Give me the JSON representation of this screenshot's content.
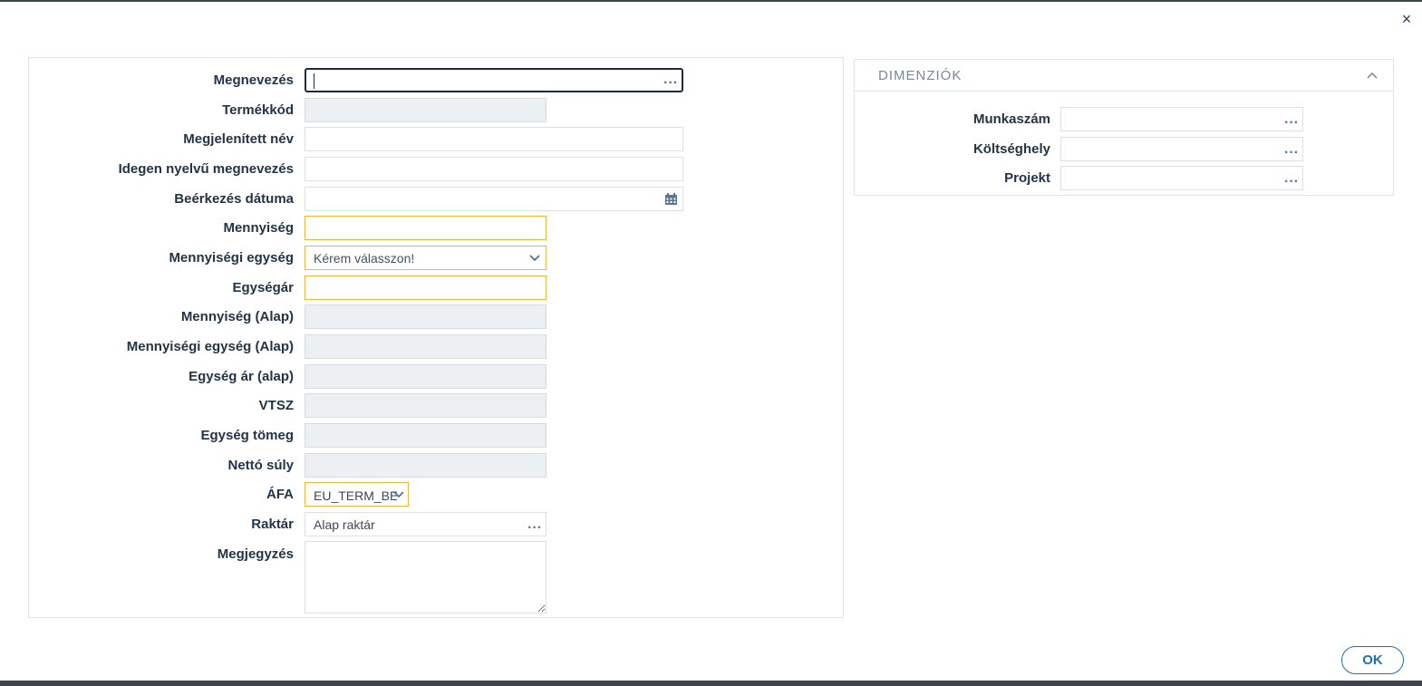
{
  "window": {
    "close_glyph": "×"
  },
  "form": {
    "fields": {
      "megnevezes": {
        "label": "Megnevezés",
        "value": ""
      },
      "termekkod": {
        "label": "Termékkód",
        "value": ""
      },
      "megjelenitett_nev": {
        "label": "Megjelenített név",
        "value": ""
      },
      "idegen_nyelvu": {
        "label": "Idegen nyelvű megnevezés",
        "value": ""
      },
      "beerkezes_datuma": {
        "label": "Beérkezés dátuma",
        "value": ""
      },
      "mennyiseg": {
        "label": "Mennyiség",
        "value": ""
      },
      "mennyisegi_egyseg": {
        "label": "Mennyiségi egység",
        "value": "Kérem válasszon!"
      },
      "egysegar": {
        "label": "Egységár",
        "value": ""
      },
      "mennyiseg_alap": {
        "label": "Mennyiség (Alap)",
        "value": ""
      },
      "mennyisegi_egyseg_alap": {
        "label": "Mennyiségi egység (Alap)",
        "value": ""
      },
      "egyseg_ar_alap": {
        "label": "Egység ár (alap)",
        "value": ""
      },
      "vtsz": {
        "label": "VTSZ",
        "value": ""
      },
      "egyseg_tomeg": {
        "label": "Egység tömeg",
        "value": ""
      },
      "netto_suly": {
        "label": "Nettó súly",
        "value": ""
      },
      "afa": {
        "label": "ÁFA",
        "value": "EU_TERM_BES"
      },
      "raktar": {
        "label": "Raktár",
        "value": "Alap raktár"
      },
      "megjegyzes": {
        "label": "Megjegyzés",
        "value": ""
      }
    }
  },
  "dimensions": {
    "title": "DIMENZIÓK",
    "collapsed": false,
    "fields": {
      "munkaszam": {
        "label": "Munkaszám",
        "value": ""
      },
      "koltseghely": {
        "label": "Költséghely",
        "value": ""
      },
      "projekt": {
        "label": "Projekt",
        "value": ""
      }
    }
  },
  "footer": {
    "ok_label": "OK"
  },
  "colors": {
    "required_border": "#f0b43c",
    "disabled_bg": "#edf0f3",
    "accent": "#1f6fa8",
    "frame": "#3d444d"
  },
  "icons": {
    "close": "close-icon",
    "calendar": "calendar-icon",
    "dropdown": "chevron-down-icon",
    "lookup": "ellipsis-icon",
    "collapse": "chevron-up-icon"
  }
}
